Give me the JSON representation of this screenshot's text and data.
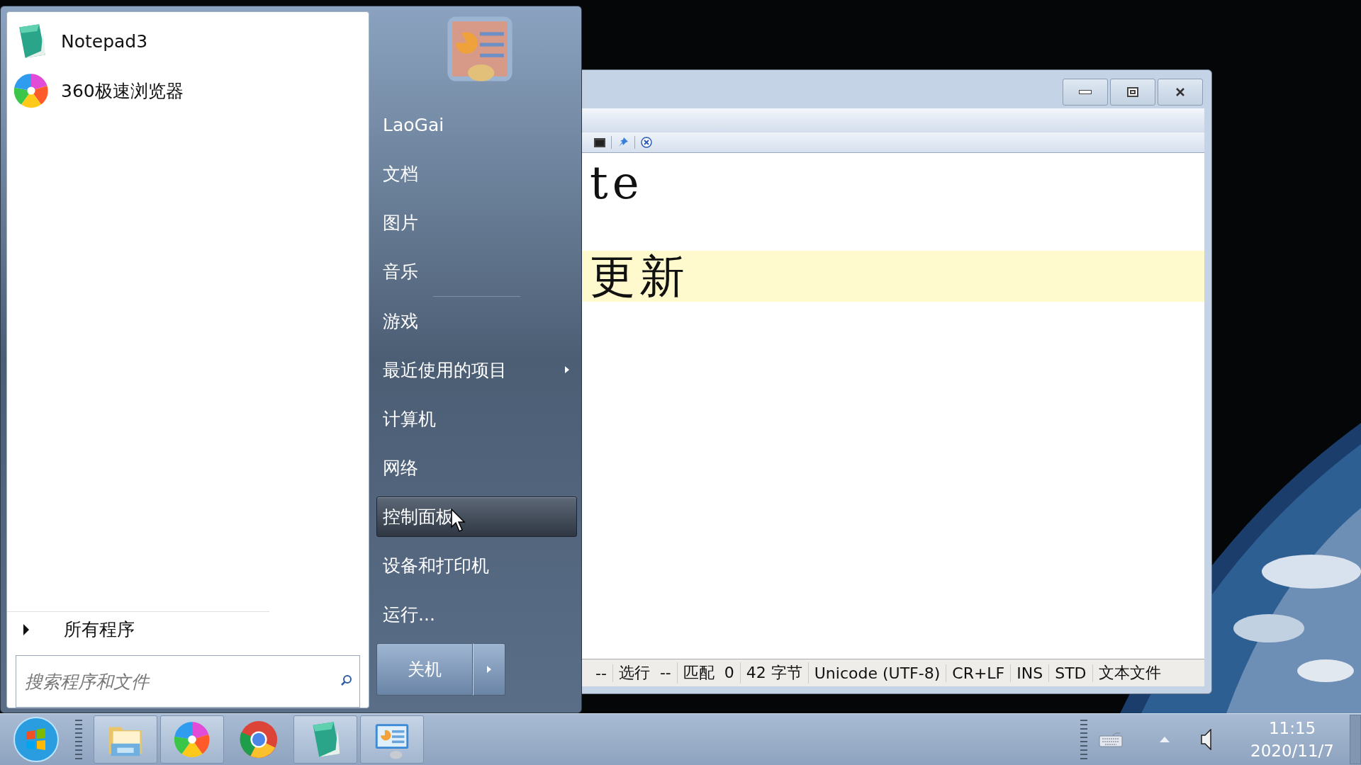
{
  "start_menu": {
    "pinned_programs": [
      {
        "kind": "notepad",
        "label": "Notepad3"
      },
      {
        "kind": "browser360",
        "label": "360极速浏览器"
      }
    ],
    "all_programs": {
      "label": "所有程序"
    },
    "search": {
      "placeholder": "搜索程序和文件"
    },
    "places": [
      {
        "label": "LaoGai",
        "selected": false,
        "has_submenu": false
      },
      {
        "label": "文档",
        "selected": false,
        "has_submenu": false
      },
      {
        "label": "图片",
        "selected": false,
        "has_submenu": false
      },
      {
        "label": "音乐",
        "selected": false,
        "has_submenu": false
      },
      {
        "label": "游戏",
        "selected": false,
        "has_submenu": false
      },
      {
        "label": "最近使用的项目",
        "selected": false,
        "has_submenu": true
      },
      {
        "label": "计算机",
        "selected": false,
        "has_submenu": false
      },
      {
        "label": "网络",
        "selected": false,
        "has_submenu": false
      },
      {
        "label": "控制面板",
        "selected": true,
        "has_submenu": false
      },
      {
        "label": "设备和打印机",
        "selected": false,
        "has_submenu": false
      },
      {
        "label": "运行...",
        "selected": false,
        "has_submenu": false
      }
    ],
    "shutdown": {
      "label": "关机"
    }
  },
  "editor": {
    "lines": [
      {
        "text": "te",
        "highlighted": false
      },
      {
        "text": "更新",
        "highlighted": true
      }
    ],
    "status_bar": [
      "--",
      "选行  --",
      "匹配  0",
      "42 字节",
      "Unicode (UTF-8)",
      "CR+LF",
      "INS",
      "STD",
      "文本文件"
    ]
  },
  "taskbar": {
    "apps": [
      {
        "kind": "folder",
        "running": true
      },
      {
        "kind": "browser360",
        "running": true
      },
      {
        "kind": "chrome",
        "running": false
      },
      {
        "kind": "notepad",
        "running": true
      },
      {
        "kind": "control",
        "running": true
      }
    ],
    "clock": {
      "time": "11:15",
      "date": "2020/11/7"
    }
  }
}
